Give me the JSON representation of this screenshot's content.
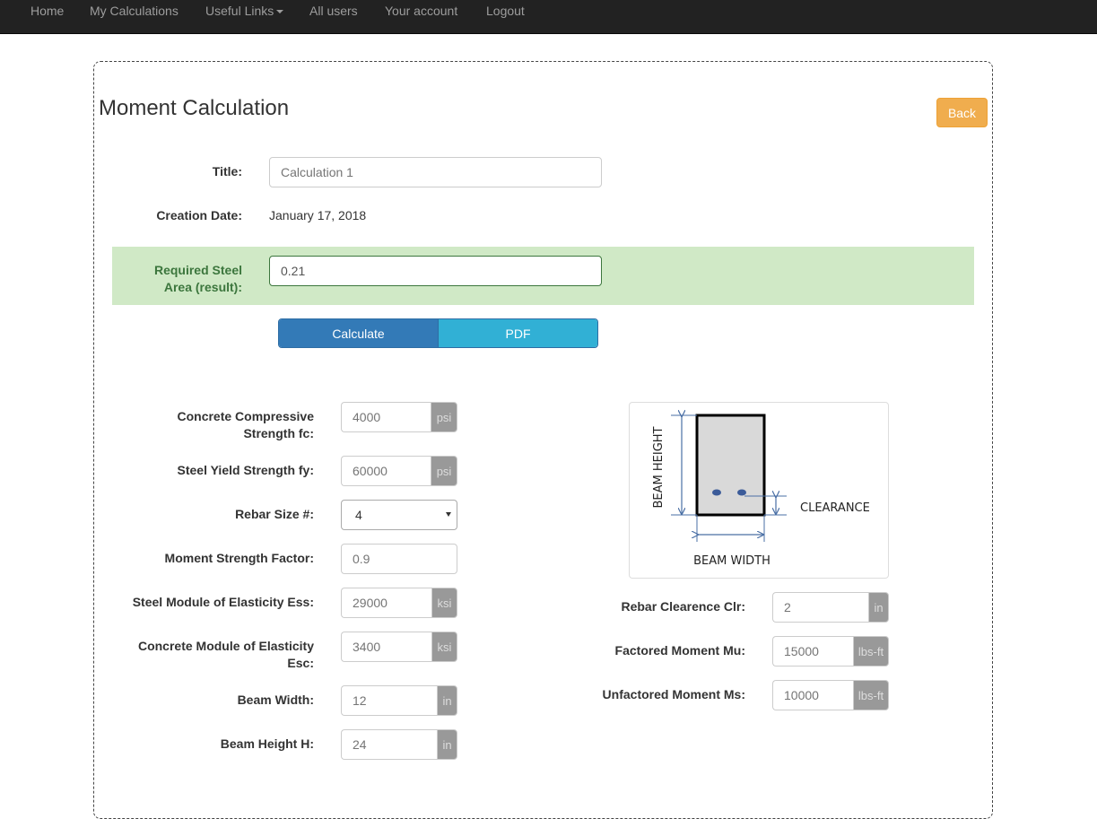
{
  "nav": {
    "home": "Home",
    "my_calculations": "My Calculations",
    "useful_links": "Useful Links",
    "all_users": "All users",
    "your_account": "Your account",
    "logout": "Logout"
  },
  "page": {
    "title": "Moment Calculation",
    "back_label": "Back"
  },
  "form": {
    "title_label": "Title:",
    "title_placeholder": "Calculation 1",
    "creation_date_label": "Creation Date:",
    "creation_date_value": "January 17, 2018",
    "result_label_line1": "Required Steel",
    "result_label_line2": "Area (result):",
    "result_value": "0.21",
    "calculate_label": "Calculate",
    "pdf_label": "PDF"
  },
  "fields_left": {
    "fc_label_line1": "Concrete Compressive",
    "fc_label_line2": "Strength fc:",
    "fc_value": "4000",
    "fc_unit": "psi",
    "fy_label": "Steel Yield Strength fy:",
    "fy_value": "60000",
    "fy_unit": "psi",
    "rebar_label": "Rebar Size #:",
    "rebar_value": "4",
    "msf_label": "Moment Strength Factor:",
    "msf_value": "0.9",
    "ess_label": "Steel Module of Elasticity Ess:",
    "ess_value": "29000",
    "ess_unit": "ksi",
    "esc_label_line1": "Concrete Module of Elasticity",
    "esc_label_line2": "Esc:",
    "esc_value": "3400",
    "esc_unit": "ksi",
    "width_label": "Beam Width:",
    "width_value": "12",
    "width_unit": "in",
    "height_label": "Beam Height H:",
    "height_value": "24",
    "height_unit": "in"
  },
  "fields_right": {
    "clr_label": "Rebar Clearence Clr:",
    "clr_value": "2",
    "clr_unit": "in",
    "mu_label": "Factored Moment Mu:",
    "mu_value": "15000",
    "mu_unit": "lbs-ft",
    "ms_label": "Unfactored Moment Ms:",
    "ms_value": "10000",
    "ms_unit": "lbs-ft"
  },
  "diagram": {
    "beam_height_label": "BEAM HEIGHT",
    "clearance_label": "CLEARANCE",
    "beam_width_label": "BEAM WIDTH"
  }
}
